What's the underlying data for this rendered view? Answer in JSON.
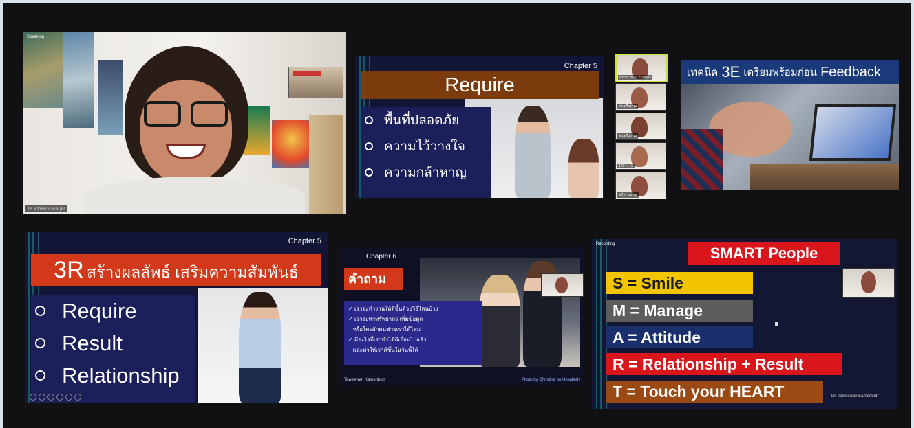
{
  "tile_speaker": {
    "name_tag": "Speaking",
    "caption": "ดร.ทวีวรรณ กมลบุตร"
  },
  "tile_require": {
    "chapter": "Chapter 5",
    "title": "Require",
    "bullets": [
      "พื้นที่ปลอดภัย",
      "ความไว้วางใจ",
      "ความกล้าหาญ"
    ]
  },
  "participants": [
    {
      "label": "ดร.ทวีวรรณ กมลบุตร"
    },
    {
      "label": "ดร.ทวีวรรณ"
    },
    {
      "label": "ดร.ทวีวรรณ"
    },
    {
      "label": "1234 / 12"
    },
    {
      "label": "ทวีวรรณ กม"
    }
  ],
  "tile_feedback": {
    "title_prefix": "เทคนิค",
    "title_highlight": "3E",
    "title_mid": "เตรียมพร้อมก่อน",
    "title_suffix": "Feedback"
  },
  "tile_3r": {
    "chapter": "Chapter 5",
    "title_big": "3R",
    "title_rest": "สร้างผลลัพธ์ เสริมความสัมพันธ์",
    "bullets": [
      "Require",
      "Result",
      "Relationship"
    ]
  },
  "tile_question": {
    "chapter": "Chapter 6",
    "title": "คำถาม",
    "lines": [
      "✓ เราจะทำงานให้ดีขึ้นด้วยวิธีไหนบ้าง",
      "✓ เราจะหาทรัพยากร เพิ่มข้อมูล",
      "   หรือใครสักคนช่วยเราได้ไหม",
      "✓ มีอะไรที่เราทำได้ดีเยี่ยมไปแล้ว",
      "   และทำให้เราดีขึ้นในวันนี้ได้"
    ],
    "footer_left": "Taweewan Kamonbutr",
    "footer_right": "Photo by Christina on Unsplash"
  },
  "tile_smart": {
    "name_tag": "Recording",
    "title": "SMART People",
    "rows": [
      {
        "text": "S = Smile",
        "color": "#f2c500"
      },
      {
        "text": "M = Manage",
        "color": "#5d5d5d"
      },
      {
        "text": "A = Attitude",
        "color": "#1a2f6e"
      },
      {
        "text": "R = Relationship + Result",
        "color": "#d9161c"
      },
      {
        "text": "T = Touch your HEART",
        "color": "#9a4a12"
      }
    ],
    "author": "Dr. Taweewan Kamonbutr"
  }
}
